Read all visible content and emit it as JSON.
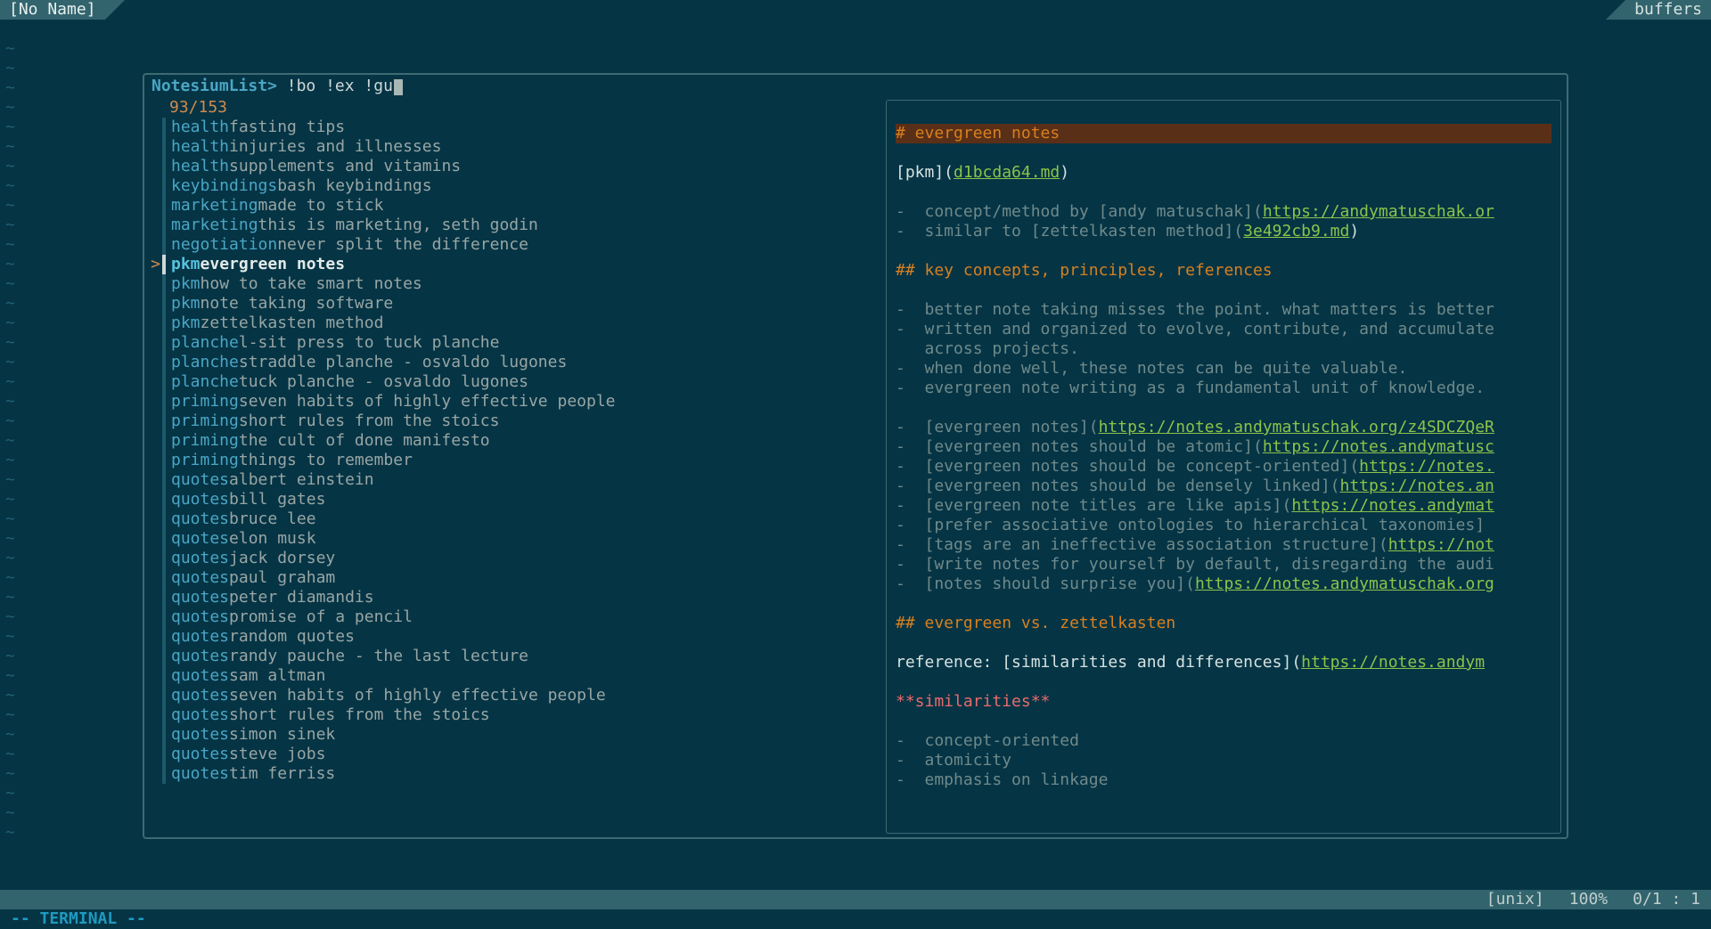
{
  "tabbar": {
    "left_tab": "[No Name]",
    "right_tab": "buffers"
  },
  "fzf": {
    "prompt_label": "NotesiumList>",
    "query": " !bo !ex !gu",
    "counter": "93/153",
    "items": [
      {
        "tag": "health",
        "title": "fasting tips"
      },
      {
        "tag": "health",
        "title": "injuries and illnesses"
      },
      {
        "tag": "health",
        "title": "supplements and vitamins"
      },
      {
        "tag": "keybindings",
        "title": "bash keybindings"
      },
      {
        "tag": "marketing",
        "title": "made to stick"
      },
      {
        "tag": "marketing",
        "title": "this is marketing, seth godin"
      },
      {
        "tag": "negotiation",
        "title": "never split the difference"
      },
      {
        "tag": "pkm",
        "title": "evergreen notes",
        "selected": true
      },
      {
        "tag": "pkm",
        "title": "how to take smart notes"
      },
      {
        "tag": "pkm",
        "title": "note taking software"
      },
      {
        "tag": "pkm",
        "title": "zettelkasten method"
      },
      {
        "tag": "planche",
        "title": "l-sit press to tuck planche"
      },
      {
        "tag": "planche",
        "title": "straddle planche - osvaldo lugones"
      },
      {
        "tag": "planche",
        "title": "tuck planche - osvaldo lugones"
      },
      {
        "tag": "priming",
        "title": "seven habits of highly effective people"
      },
      {
        "tag": "priming",
        "title": "short rules from the stoics"
      },
      {
        "tag": "priming",
        "title": "the cult of done manifesto"
      },
      {
        "tag": "priming",
        "title": "things to remember"
      },
      {
        "tag": "quotes",
        "title": "albert einstein"
      },
      {
        "tag": "quotes",
        "title": "bill gates"
      },
      {
        "tag": "quotes",
        "title": "bruce lee"
      },
      {
        "tag": "quotes",
        "title": "elon musk"
      },
      {
        "tag": "quotes",
        "title": "jack dorsey"
      },
      {
        "tag": "quotes",
        "title": "paul graham"
      },
      {
        "tag": "quotes",
        "title": "peter diamandis"
      },
      {
        "tag": "quotes",
        "title": "promise of a pencil"
      },
      {
        "tag": "quotes",
        "title": "random quotes"
      },
      {
        "tag": "quotes",
        "title": "randy pauche - the last lecture"
      },
      {
        "tag": "quotes",
        "title": "sam altman"
      },
      {
        "tag": "quotes",
        "title": "seven habits of highly effective people"
      },
      {
        "tag": "quotes",
        "title": "short rules from the stoics"
      },
      {
        "tag": "quotes",
        "title": "simon sinek"
      },
      {
        "tag": "quotes",
        "title": "steve jobs"
      },
      {
        "tag": "quotes",
        "title": "tim ferriss"
      }
    ]
  },
  "preview": {
    "title": "# evergreen notes",
    "pkm_label": "[pkm](",
    "pkm_link": "d1bcda64.md",
    "pkm_close": ")",
    "b1a": "-  concept/method by [andy matuschak](",
    "b1link": "https://andymatuschak.or",
    "b2a": "-  similar to [zettelkasten method](",
    "b2link": "3e492cb9.md",
    "close_paren": ")",
    "h2a": "## key concepts, principles, references",
    "kc1": "-  better note taking misses the point. what matters is better",
    "kc2": "-  written and organized to evolve, contribute, and accumulate",
    "kc2b": "   across projects.",
    "kc3": "-  when done well, these notes can be quite valuable.",
    "kc4": "-  evergreen note writing as a fundamental unit of knowledge.",
    "l1a": "-  [evergreen notes](",
    "l1link": "https://notes.andymatuschak.org/z4SDCZQeR",
    "l2a": "-  [evergreen notes should be atomic](",
    "l2link": "https://notes.andymatusc",
    "l3a": "-  [evergreen notes should be concept-oriented](",
    "l3link": "https://notes.",
    "l4a": "-  [evergreen notes should be densely linked](",
    "l4link": "https://notes.an",
    "l5a": "-  [evergreen note titles are like apis](",
    "l5link": "https://notes.andymat",
    "l6": "-  [prefer associative ontologies to hierarchical taxonomies]",
    "l7a": "-  [tags are an ineffective association structure](",
    "l7link": "https://not",
    "l8": "-  [write notes for yourself by default, disregarding the audi",
    "l9a": "-  [notes should surprise you](",
    "l9link": "https://notes.andymatuschak.org",
    "h2b": "## evergreen vs. zettelkasten",
    "refa": "reference: [similarities and differences](",
    "reflink": "https://notes.andym",
    "sim_hdr": "**similarities**",
    "s1": "-  concept-oriented",
    "s2": "-  atomicity",
    "s3": "-  emphasis on linkage"
  },
  "status": {
    "encoding": "[unix]",
    "percent": "100%",
    "pos": "0/1 :  1"
  },
  "mode_line": "-- TERMINAL --"
}
